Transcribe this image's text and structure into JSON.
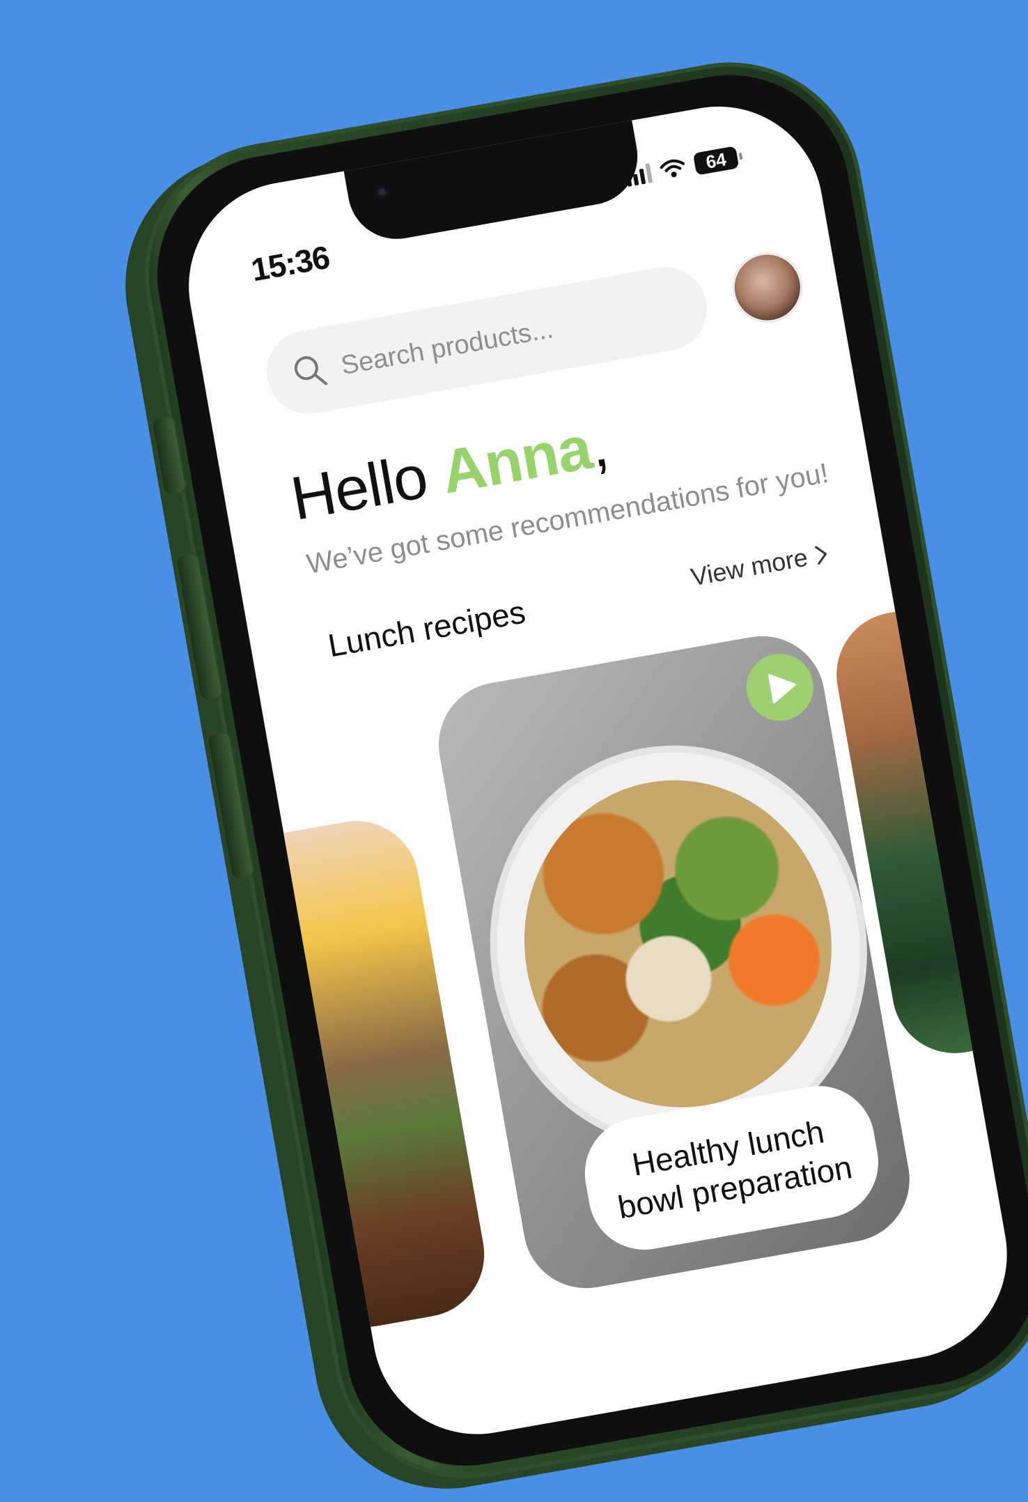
{
  "status_bar": {
    "time": "15:36",
    "battery": "64"
  },
  "search": {
    "placeholder": "Search products..."
  },
  "greeting": {
    "hello": "Hello ",
    "name": "Anna",
    "comma": ",",
    "subtitle": "We’ve got some recommendations for you!"
  },
  "section": {
    "title": "Lunch recipes",
    "view_more": "View more"
  },
  "cards": [
    {
      "title": "Healthy lunch bowl preparation"
    }
  ],
  "colors": {
    "background": "#4a8fe6",
    "accent_green": "#97d36a",
    "phone_frame": "#2a4a28"
  },
  "icons": [
    "signal-icon",
    "wifi-icon",
    "battery-icon",
    "search-icon",
    "chevron-right-icon",
    "play-icon"
  ]
}
